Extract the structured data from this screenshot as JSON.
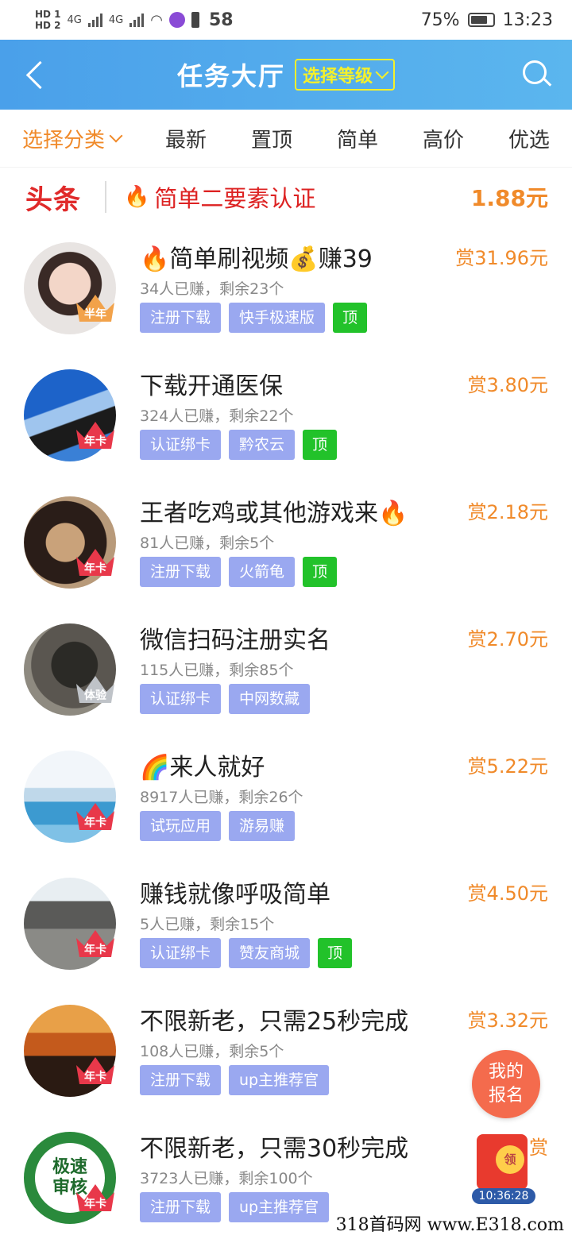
{
  "status_bar": {
    "signal_labels": [
      "HD 1",
      "HD 2",
      "4G",
      "4G"
    ],
    "notification_count": "58",
    "battery": "75%",
    "time": "13:23"
  },
  "header": {
    "title": "任务大厅",
    "level_button": "选择等级"
  },
  "tabs": [
    {
      "label": "选择分类",
      "active": true
    },
    {
      "label": "最新"
    },
    {
      "label": "置顶"
    },
    {
      "label": "简单"
    },
    {
      "label": "高价"
    },
    {
      "label": "优选"
    }
  ],
  "headline": {
    "logo": "头条",
    "text": "简单二要素认证",
    "amount": "1.88元"
  },
  "tasks": [
    {
      "title": "🔥简单刷视频💰赚39",
      "stats": "34人已赚，剩余23个",
      "reward": "赏31.96元",
      "badge": "半年",
      "tags": [
        "注册下载",
        "快手极速版"
      ],
      "top": "顶"
    },
    {
      "title": "下载开通医保",
      "stats": "324人已赚，剩余22个",
      "reward": "赏3.80元",
      "badge": "年卡",
      "tags": [
        "认证绑卡",
        "黔农云"
      ],
      "top": "顶"
    },
    {
      "title": "王者吃鸡或其他游戏来🔥",
      "stats": "81人已赚，剩余5个",
      "reward": "赏2.18元",
      "badge": "年卡",
      "tags": [
        "注册下载",
        "火箭龟"
      ],
      "top": "顶"
    },
    {
      "title": "微信扫码注册实名",
      "stats": "115人已赚，剩余85个",
      "reward": "赏2.70元",
      "badge": "体验",
      "tags": [
        "认证绑卡",
        "中网数藏"
      ]
    },
    {
      "title": "🌈来人就好",
      "stats": "8917人已赚，剩余26个",
      "reward": "赏5.22元",
      "badge": "年卡",
      "tags": [
        "试玩应用",
        "游易赚"
      ]
    },
    {
      "title": "赚钱就像呼吸简单",
      "stats": "5人已赚，剩余15个",
      "reward": "赏4.50元",
      "badge": "年卡",
      "tags": [
        "认证绑卡",
        "赞友商城"
      ],
      "top": "顶"
    },
    {
      "title": "不限新老，只需25秒完成",
      "stats": "108人已赚，剩余5个",
      "reward": "赏3.32元",
      "badge": "年卡",
      "tags": [
        "注册下载",
        "up主推荐官"
      ]
    },
    {
      "title": "不限新老，只需30秒完成",
      "stats": "3723人已赚，剩余100个",
      "reward": "赏",
      "badge": "年卡",
      "avatar_text": "极速审核",
      "tags": [
        "注册下载",
        "up主推荐官"
      ]
    }
  ],
  "fab": {
    "line1": "我的",
    "line2": "报名"
  },
  "red_packet": {
    "coin": "领",
    "time": "10:36:28"
  },
  "watermark": "318首码网 www.E318.com",
  "colors": {
    "header_blue": "#4aa0ea",
    "accent_orange": "#f08a2a",
    "tag_blue": "#9aa8f0",
    "tag_green": "#22c22a",
    "headline_red": "#e02a2a"
  }
}
